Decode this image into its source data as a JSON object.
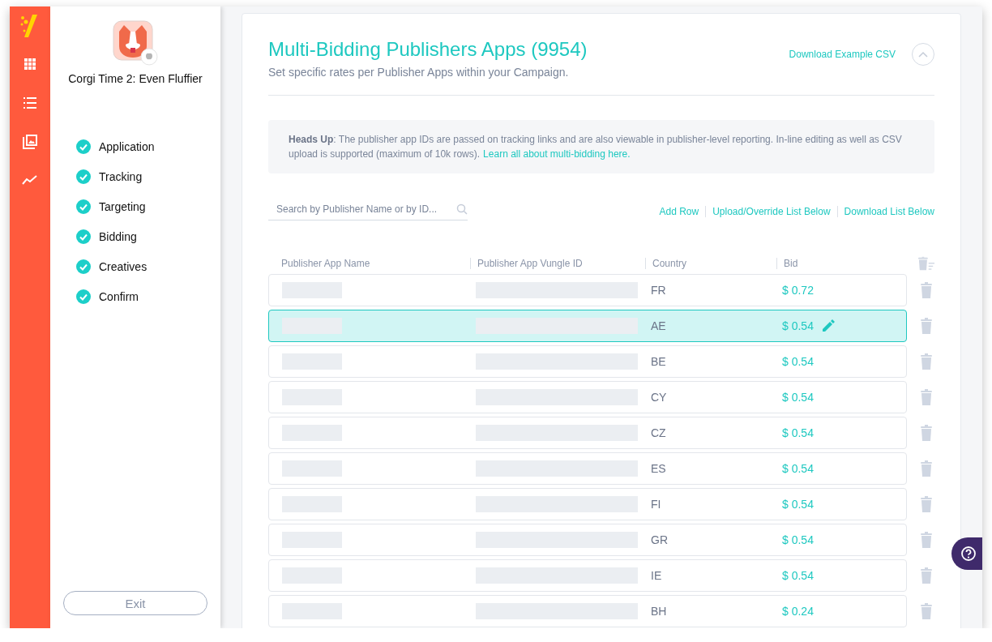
{
  "sidebar": {
    "app_name": "Corgi Time 2: Even Fluffier",
    "steps": [
      {
        "label": "Application",
        "completed": true
      },
      {
        "label": "Tracking",
        "completed": true
      },
      {
        "label": "Targeting",
        "completed": true
      },
      {
        "label": "Bidding",
        "completed": true
      },
      {
        "label": "Creatives",
        "completed": true
      },
      {
        "label": "Confirm",
        "completed": true
      }
    ],
    "exit_button": "Exit"
  },
  "panel": {
    "title": "Multi-Bidding Publishers Apps (9954)",
    "subtitle": "Set specific rates per Publisher Apps within your Campaign.",
    "download_example": "Download Example CSV",
    "expanded": true,
    "notice": {
      "text": "**Heads Up**: The publisher app IDs are passed on tracking links and are also viewable in publisher-level reporting. In-line editing as well as CSV upload is supported (maximum of 10k rows).",
      "link": "Learn all about multi-bidding here."
    },
    "search": {
      "placeholder": "Search by Publisher Name or by ID..."
    },
    "actions": [
      "Add Row",
      "Upload/Override List Below",
      "Download List Below"
    ],
    "columns": [
      "Publisher App Name",
      "Publisher App Vungle ID",
      "Country",
      "Bid"
    ],
    "rows": [
      {
        "country": "FR",
        "bid": "$ 0.72",
        "selected": false
      },
      {
        "country": "AE",
        "bid": "$ 0.54",
        "selected": true
      },
      {
        "country": "BE",
        "bid": "$ 0.54",
        "selected": false
      },
      {
        "country": "CY",
        "bid": "$ 0.54",
        "selected": false
      },
      {
        "country": "CZ",
        "bid": "$ 0.54",
        "selected": false
      },
      {
        "country": "ES",
        "bid": "$ 0.54",
        "selected": false
      },
      {
        "country": "FI",
        "bid": "$ 0.54",
        "selected": false
      },
      {
        "country": "GR",
        "bid": "$ 0.54",
        "selected": false
      },
      {
        "country": "IE",
        "bid": "$ 0.54",
        "selected": false
      },
      {
        "country": "BH",
        "bid": "$ 0.24",
        "selected": false
      }
    ]
  }
}
